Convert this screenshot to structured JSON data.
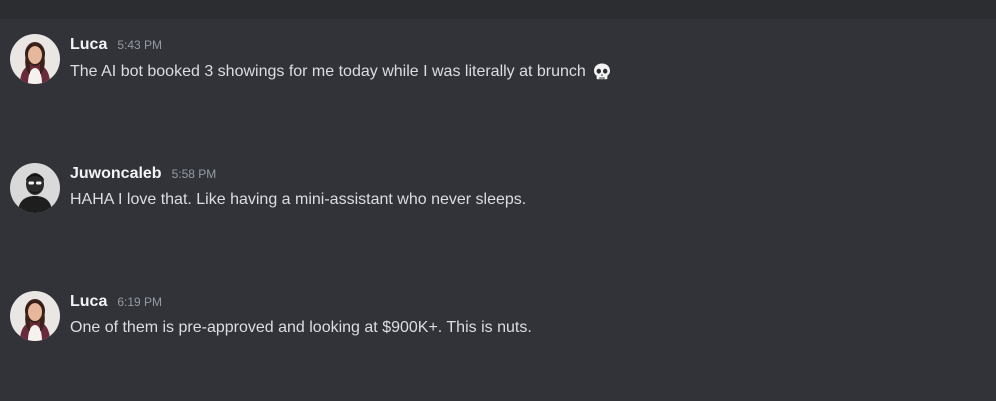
{
  "messages": [
    {
      "author": "Luca",
      "time": "5:43 PM",
      "text": "The AI bot booked 3 showings for me today while I was literally at brunch",
      "emoji": "skull-emoji"
    },
    {
      "author": "Juwoncaleb",
      "time": "5:58 PM",
      "text": "HAHA I love that. Like having a mini-assistant who never sleeps."
    },
    {
      "author": "Luca",
      "time": "6:19 PM",
      "text": "One of them is pre-approved and looking at $900K+. This is nuts."
    }
  ],
  "colors": {
    "background": "#313338",
    "topbar": "#2b2d31",
    "username": "#f2f3f5",
    "timestamp": "#949ba4",
    "message_text": "#dbdee1"
  }
}
